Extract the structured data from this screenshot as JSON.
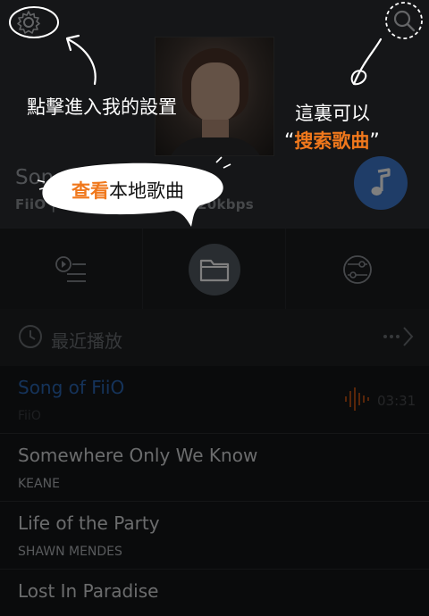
{
  "now_playing": {
    "title": "Song of FiiO",
    "meta": "FiiO | 16kHz | 16bits | 320kbps"
  },
  "recent": {
    "label": "最近播放"
  },
  "songs": [
    {
      "title": "Song of FiiO",
      "artist": "FiiO",
      "duration": "03:31"
    },
    {
      "title": "Somewhere Only We Know",
      "artist": "KEANE"
    },
    {
      "title": "Life of the Party",
      "artist": "SHAWN MENDES"
    },
    {
      "title": "Lost In Paradise",
      "artist": ""
    }
  ],
  "guides": {
    "settings": "點擊進入我的設置",
    "search_line1": "這裏可以",
    "search_open_quote": "“",
    "search_highlight": "搜索歌曲",
    "search_close_quote": "”",
    "local_highlight": "查看",
    "local_rest": "本地歌曲"
  },
  "colors": {
    "accent_blue": "#3f7bd0",
    "highlight_orange": "#f0781c",
    "active_song": "#2a67b5"
  }
}
